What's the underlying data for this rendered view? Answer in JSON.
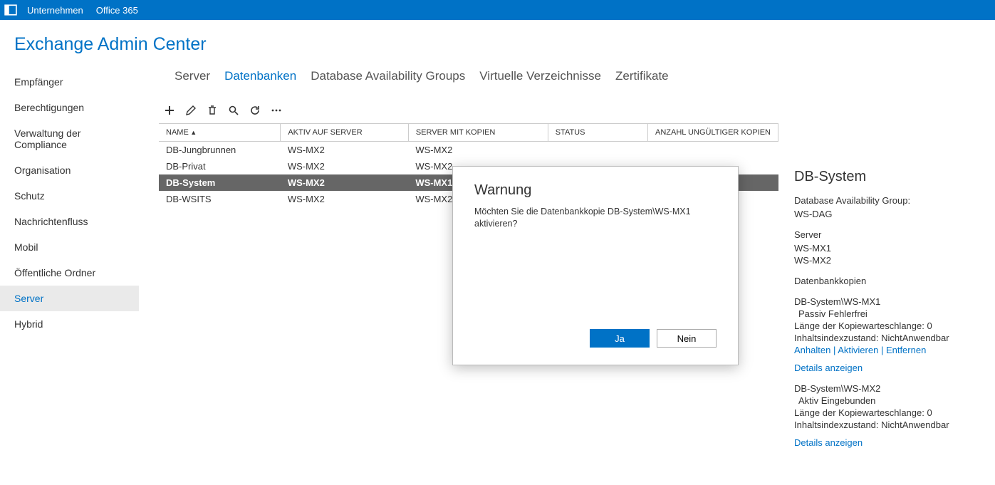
{
  "topbar": {
    "company": "Unternehmen",
    "o365": "Office 365"
  },
  "page_title": "Exchange Admin Center",
  "sidebar": {
    "items": [
      "Empfänger",
      "Berechtigungen",
      "Verwaltung der Compliance",
      "Organisation",
      "Schutz",
      "Nachrichtenfluss",
      "Mobil",
      "Öffentliche Ordner",
      "Server",
      "Hybrid"
    ],
    "active_index": 8
  },
  "tabs": {
    "items": [
      "Server",
      "Datenbanken",
      "Database Availability Groups",
      "Virtuelle Verzeichnisse",
      "Zertifikate"
    ],
    "active_index": 1
  },
  "columns": {
    "name": "NAME",
    "active_on": "AKTIV AUF SERVER",
    "copies": "SERVER MIT KOPIEN",
    "status": "STATUS",
    "invalid": "ANZAHL UNGÜLTIGER KOPIEN"
  },
  "rows": [
    {
      "name": "DB-Jungbrunnen",
      "active_on": "WS-MX2",
      "copies": "WS-MX2"
    },
    {
      "name": "DB-Privat",
      "active_on": "WS-MX2",
      "copies": "WS-MX2"
    },
    {
      "name": "DB-System",
      "active_on": "WS-MX2",
      "copies": "WS-MX1"
    },
    {
      "name": "DB-WSITS",
      "active_on": "WS-MX2",
      "copies": "WS-MX2"
    }
  ],
  "selected_index": 2,
  "details": {
    "title": "DB-System",
    "dag_label": "Database Availability Group:",
    "dag_value": "WS-DAG",
    "server_label": "Server",
    "servers": [
      "WS-MX1",
      "WS-MX2"
    ],
    "copies_label": "Datenbankkopien",
    "copies": [
      {
        "name": "DB-System\\WS-MX1",
        "state": "Passiv Fehlerfrei",
        "queue": "Länge der Kopiewarteschlange:  0",
        "index": "Inhaltsindexzustand:  NichtAnwendbar",
        "actions": {
          "pause": "Anhalten",
          "activate": "Aktivieren",
          "remove": "Entfernen"
        },
        "details_link": "Details anzeigen"
      },
      {
        "name": "DB-System\\WS-MX2",
        "state": "Aktiv Eingebunden",
        "queue": "Länge der Kopiewarteschlange:  0",
        "index": "Inhaltsindexzustand:  NichtAnwendbar",
        "details_link": "Details anzeigen"
      }
    ]
  },
  "dialog": {
    "title": "Warnung",
    "message": "Möchten Sie die Datenbankkopie DB-System\\WS-MX1 aktivieren?",
    "yes": "Ja",
    "no": "Nein"
  }
}
